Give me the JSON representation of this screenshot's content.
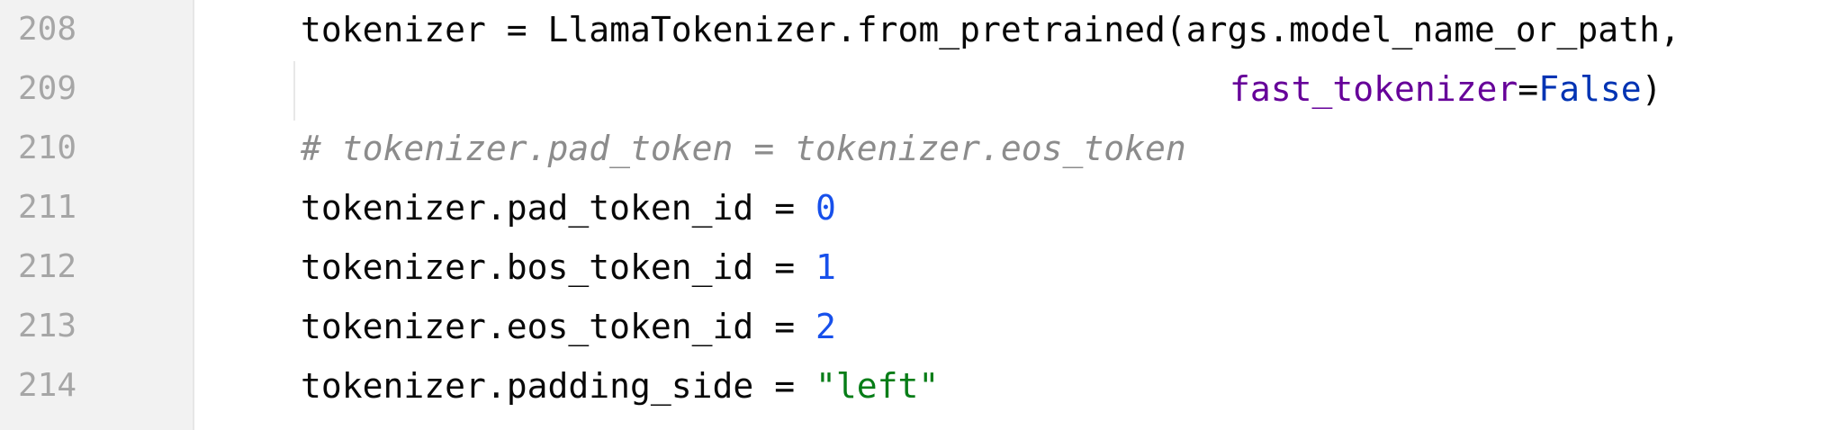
{
  "editor": {
    "lines": [
      {
        "number": "208",
        "code": "tokenizer = LlamaTokenizer.from_pretrained(args.model_name_or_path,"
      },
      {
        "number": "209",
        "kwarg": "fast_tokenizer",
        "equals": "=",
        "value": "False",
        "close": ")"
      },
      {
        "number": "210",
        "comment": "# tokenizer.pad_token = tokenizer.eos_token"
      },
      {
        "number": "211",
        "prefix": "tokenizer.pad_token_id = ",
        "value": "0"
      },
      {
        "number": "212",
        "prefix": "tokenizer.bos_token_id = ",
        "value": "1"
      },
      {
        "number": "213",
        "prefix": "tokenizer.eos_token_id = ",
        "value": "2"
      },
      {
        "number": "214",
        "prefix": "tokenizer.padding_side = ",
        "value": "\"left\""
      }
    ]
  },
  "colors": {
    "gutter_background": "#f2f2f2",
    "line_number": "#a6a6a6",
    "default_text": "#080808",
    "comment": "#8c8c8c",
    "number": "#1750eb",
    "keyword_argument": "#660099",
    "constant": "#0033b3",
    "string": "#067d17"
  }
}
